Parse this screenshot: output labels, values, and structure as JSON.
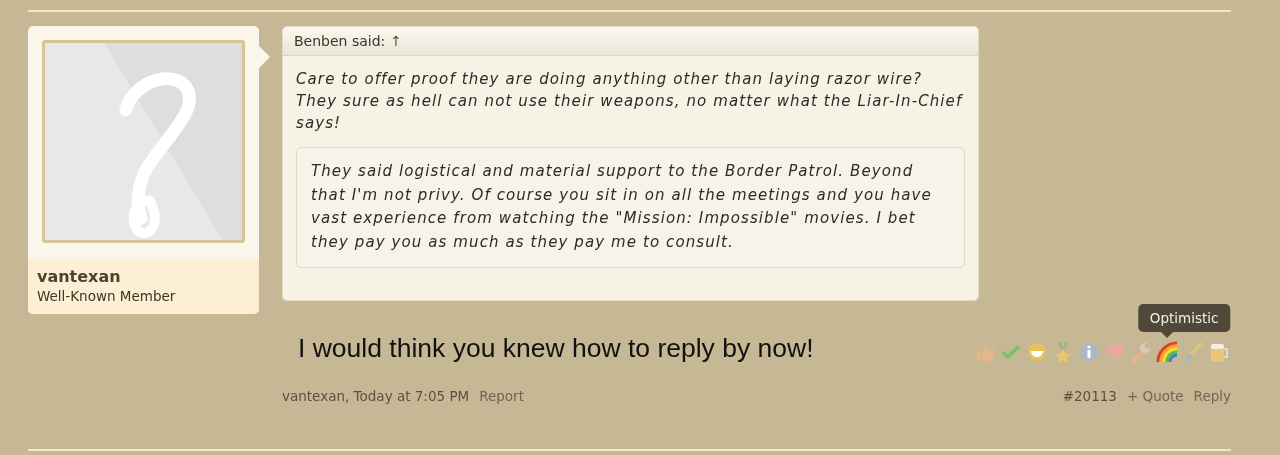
{
  "author": {
    "name": "vantexan",
    "title": "Well-Known Member"
  },
  "quote": {
    "attribution": "Benben said:",
    "link": "↑",
    "text": "Care to offer proof they are doing anything other than laying razor wire? They sure as hell can not use their weapons, no matter what the Liar-In-Chief says!",
    "reply": "They said logistical and material support to the Border Patrol. Beyond that I'm not privy. Of course you sit in on all the meetings and you have vast experience from watching the \"Mission: Impossible\" movies. I bet they pay you as much as they pay me to consult."
  },
  "message": "I would think you knew how to reply by now!",
  "ratings": [
    {
      "kind": "thumb"
    },
    {
      "kind": "check"
    },
    {
      "kind": "grin"
    },
    {
      "kind": "medal"
    },
    {
      "kind": "info"
    },
    {
      "kind": "heart"
    },
    {
      "kind": "wrench"
    },
    {
      "kind": "rainbow",
      "tooltip": "Optimistic"
    },
    {
      "kind": "brush"
    },
    {
      "kind": "mug"
    }
  ],
  "footer": {
    "byline": "vantexan, Today at 7:05 PM",
    "report": "Report",
    "post_number": "#20113",
    "quote": "+ Quote",
    "reply": "Reply"
  }
}
